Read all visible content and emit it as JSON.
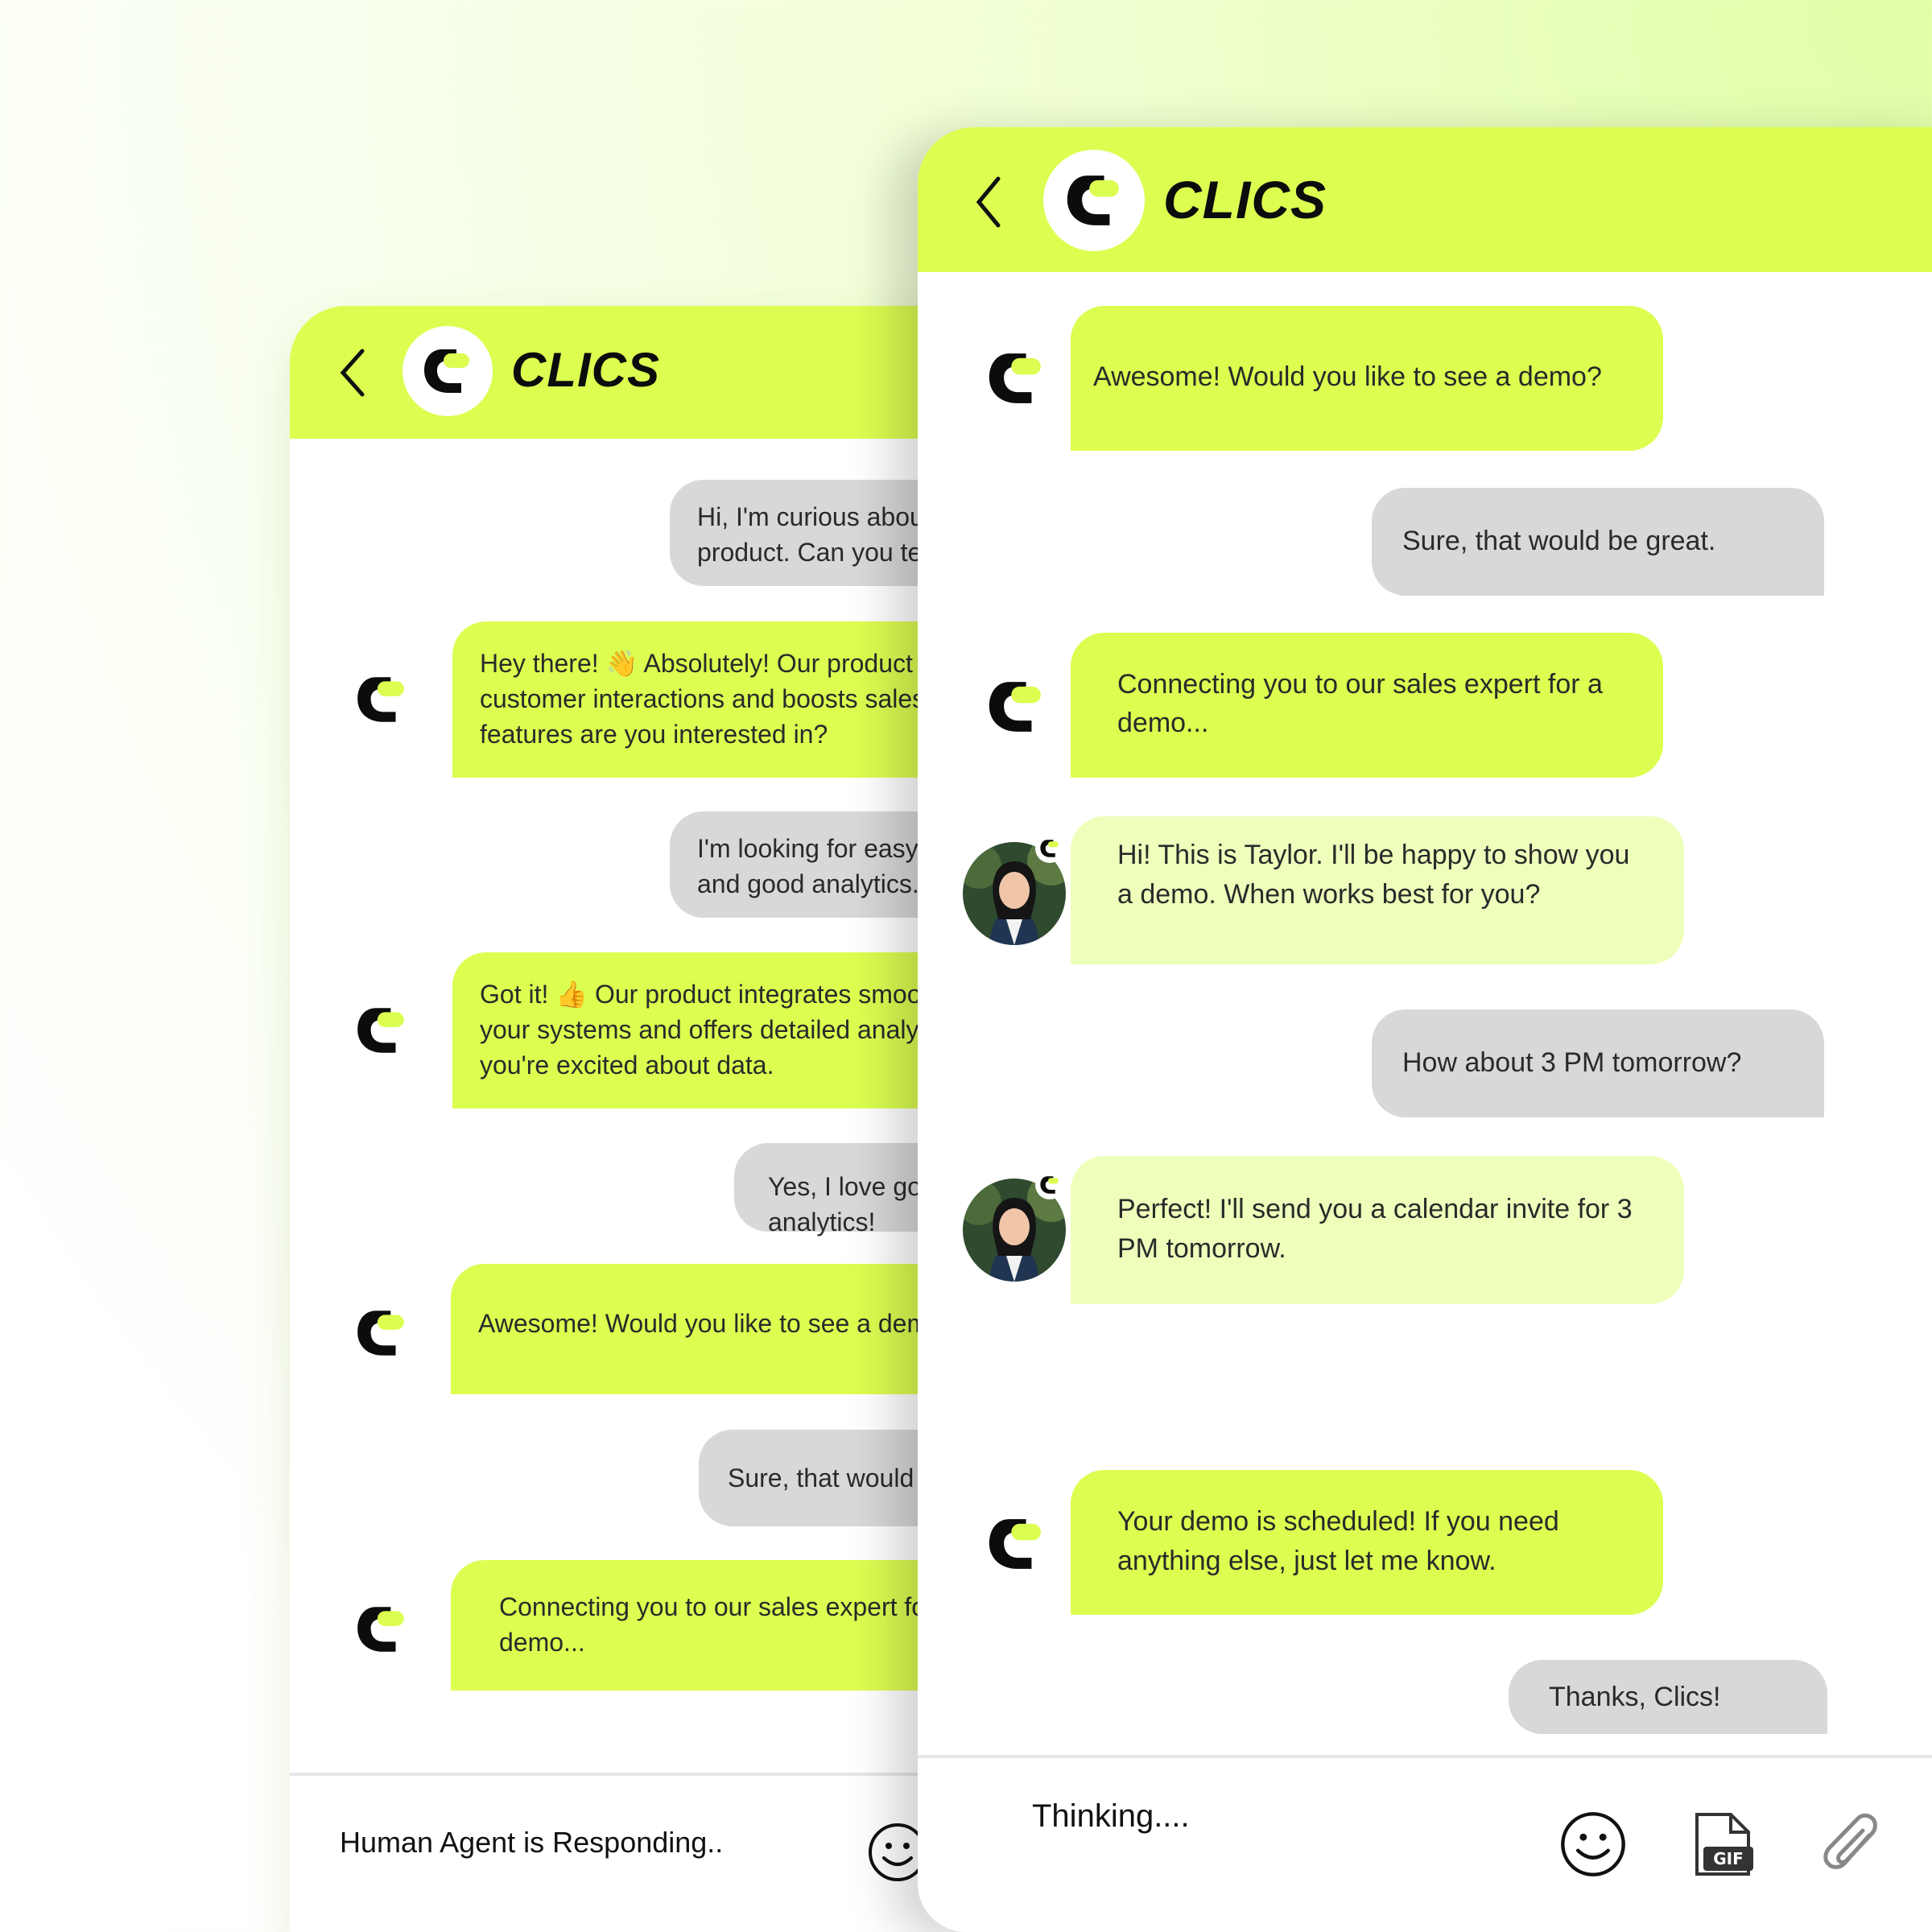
{
  "brand": {
    "name": "CLICS",
    "accent": "#dcfe50",
    "agent_bubble": "#eeffbb",
    "user_bubble": "#d8d8d8"
  },
  "back_window": {
    "messages": [
      {
        "role": "user",
        "text": "Hi, I'm curious about your product. Can you tell me more?"
      },
      {
        "role": "bot",
        "text": "Hey there! 👋 Absolutely! Our product streamlines customer interactions and boosts sales. What features are you interested in?"
      },
      {
        "role": "user",
        "text": "I'm looking for easy integration and good analytics."
      },
      {
        "role": "bot",
        "text": "Got it! 👍 Our product integrates smoothly with your systems and offers detailed analytics. I sense you're excited about data."
      },
      {
        "role": "user",
        "text": "Yes, I love good analytics!"
      },
      {
        "role": "bot",
        "text": "Awesome! Would you like to see a demo?"
      },
      {
        "role": "user",
        "text": "Sure, that would be great."
      },
      {
        "role": "bot",
        "text": "Connecting you to our sales expert for a demo..."
      }
    ],
    "status": "Human Agent is Responding.."
  },
  "front_window": {
    "messages": [
      {
        "role": "bot",
        "text": "Awesome! Would you like to see a demo?"
      },
      {
        "role": "user",
        "text": "Sure, that would be great."
      },
      {
        "role": "bot",
        "text": "Connecting you to our sales expert for a demo..."
      },
      {
        "role": "agent",
        "text": "Hi! This is Taylor. I'll be happy to show you a demo. When works best for you?"
      },
      {
        "role": "user",
        "text": "How about 3 PM tomorrow?"
      },
      {
        "role": "agent",
        "text": "Perfect! I'll send you a calendar invite for 3 PM tomorrow."
      },
      {
        "role": "bot",
        "text": "Your demo is scheduled! If you need anything else, just let me know."
      },
      {
        "role": "user",
        "text": "Thanks, Clics!"
      }
    ],
    "status": "Thinking....",
    "toolbar": [
      "emoji-icon",
      "gif-icon",
      "paperclip-icon"
    ]
  }
}
